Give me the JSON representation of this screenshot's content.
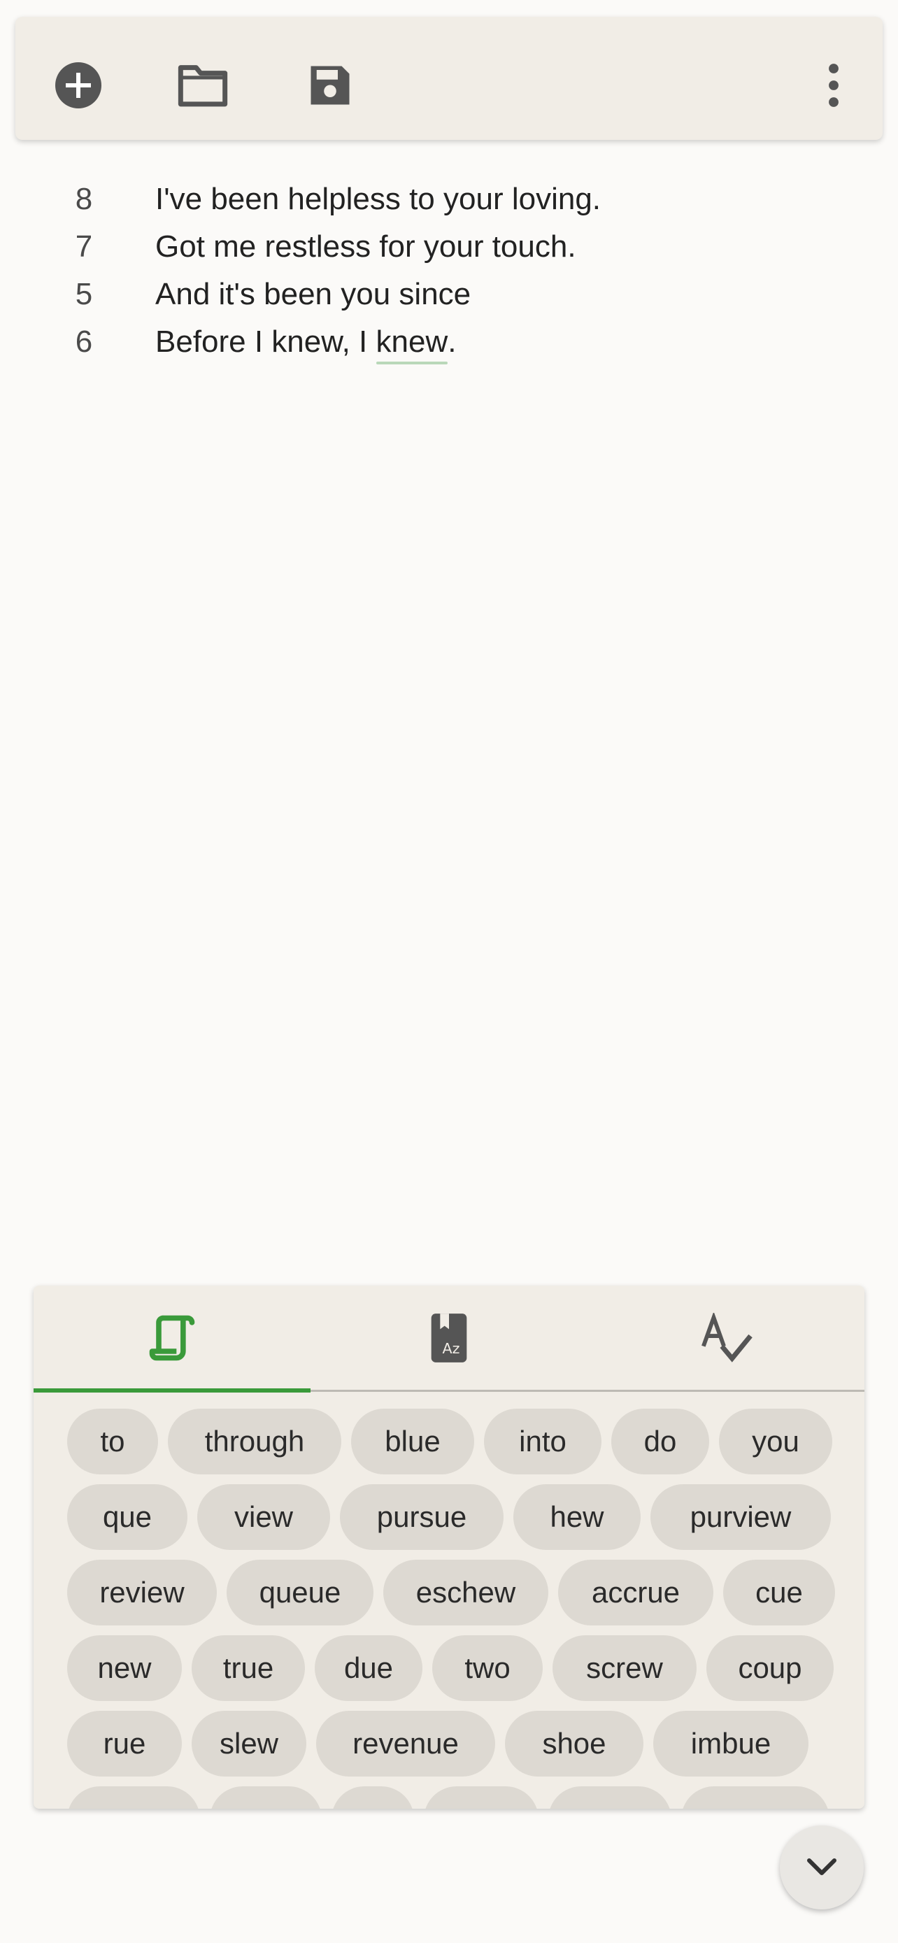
{
  "toolbar": {
    "actions": [
      {
        "name": "new",
        "icon": "add-circle-icon"
      },
      {
        "name": "open",
        "icon": "folder-icon"
      },
      {
        "name": "save",
        "icon": "save-icon"
      },
      {
        "name": "more",
        "icon": "more-vertical-icon"
      }
    ]
  },
  "editor": {
    "lines": [
      {
        "number": "8",
        "text": "I've been helpless to your loving."
      },
      {
        "number": "7",
        "text": "Got me restless for your touch."
      },
      {
        "number": "5",
        "text": "And it's been you since"
      },
      {
        "number": "6",
        "text_before": "Before I knew, I ",
        "highlight": "knew",
        "text_after": "."
      }
    ]
  },
  "panel": {
    "tabs": [
      {
        "name": "rhymes",
        "icon": "scroll-icon",
        "active": true
      },
      {
        "name": "dictionary",
        "icon": "dictionary-icon",
        "active": false
      },
      {
        "name": "spellcheck",
        "icon": "spellcheck-icon",
        "active": false
      }
    ],
    "word_rows": [
      [
        "to",
        "through",
        "blue",
        "into",
        "do",
        "you"
      ],
      [
        "que",
        "view",
        "pursue",
        "hew",
        "purview"
      ],
      [
        "review",
        "queue",
        "eschew",
        "accrue",
        "cue"
      ],
      [
        "new",
        "true",
        "due",
        "two",
        "screw",
        "coup"
      ],
      [
        "rue",
        "slew",
        "revenue",
        "shoe",
        "imbue"
      ]
    ]
  },
  "fab": {
    "icon": "chevron-down-icon"
  },
  "colors": {
    "accent": "#3a9a3a",
    "toolbar_bg": "#f1ede6",
    "chip_bg": "#ddd9d2",
    "icon": "#555555"
  }
}
